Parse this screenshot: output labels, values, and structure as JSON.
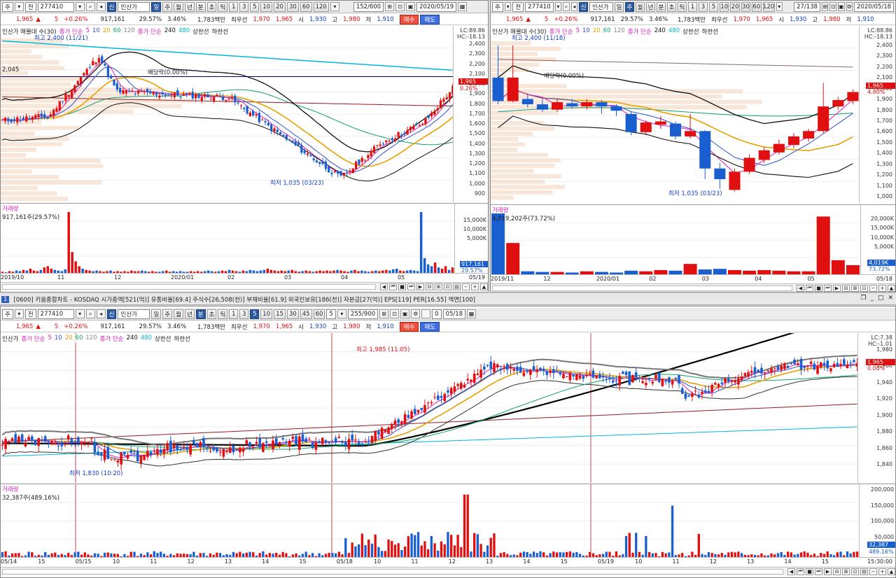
{
  "colors": {
    "up": "#e01010",
    "down": "#1a5fd0",
    "ma5": "#e020c0",
    "ma20": "#e8a000",
    "ma60": "#10a070",
    "ma120": "#00b8d8",
    "bb": "#111111"
  },
  "toolbar": {
    "mode": "주",
    "type": "전",
    "code": "277410",
    "badge": "신",
    "name": "인산가",
    "periods_left": [
      "일",
      "주",
      "월",
      "년",
      "분",
      "초",
      "틱"
    ],
    "periods_bottom": [
      "일",
      "주",
      "월",
      "년",
      "분",
      "초",
      "틱"
    ],
    "nums": [
      "1",
      "3",
      "5",
      "10",
      "20",
      "30",
      "60",
      "120"
    ],
    "nums_bottom": [
      "1",
      "3",
      "5",
      "10",
      "15",
      "30",
      "45",
      "60"
    ],
    "tl_count": "152/600",
    "tr_count": "27/138",
    "b_count": "255/900",
    "b_sel": "5",
    "tl_date": "2020/05/19",
    "tr_date": "2020/05/18",
    "b_date": "05/18",
    "b_zero": "0"
  },
  "quote": {
    "price": "1,965",
    "arrow": "▲",
    "change": "5",
    "pct": "+0.26%",
    "volume": "917,161",
    "turnover_rate": "29.57%",
    "r2": "3.46%",
    "amount": "1,783백만",
    "priority": "최우선",
    "ask": "1,970",
    "bid": "1,965",
    "open_l": "시",
    "open": "1,930",
    "high_l": "고",
    "high": "1,980",
    "low_l": "저",
    "low": "1,910",
    "buy": "매수",
    "sell": "매도"
  },
  "legend_price": {
    "name": "인산가 매물대 수(30)",
    "ma_label": "종가 단순",
    "ma": [
      "5",
      "10",
      "20",
      "60",
      "120"
    ],
    "ma2_label": "종가 단순",
    "ma2": [
      "240",
      "480"
    ],
    "band": "상한선",
    "band2": "하한선"
  },
  "legend_bottom": {
    "name": "인산가",
    "ma_label": "종가 단순",
    "ma": [
      "5",
      "10",
      "20",
      "60",
      "120"
    ],
    "ma2_label": "종가 단순",
    "ma2": [
      "240",
      "480"
    ],
    "band": "상한선",
    "band2": "하한선"
  },
  "tl": {
    "lc": "LC:89.86",
    "hc": "HC:-18.13",
    "yticks": [
      "2,400",
      "2,300",
      "2,200",
      "2,100",
      "2,000",
      "1,900",
      "1,800",
      "1,700",
      "1,600",
      "1,500",
      "1,400",
      "1,300",
      "1,200",
      "1,100",
      "1,000",
      "900"
    ],
    "tag_price": "1,965",
    "tag_pct": "0.26%",
    "hi_note": "최고 2,400 (11/21)",
    "lo_note": "최저 1,035 (03/23)",
    "div_note": "배당락(0.00%)",
    "hline_label": "2,045",
    "vol_title": "거래량",
    "vol_val": "917,161주(29.57%)",
    "vticks": [
      "15,000K",
      "10,000K",
      "5,000K"
    ],
    "vtag": "917,161",
    "vtag2": "29.57%",
    "xlabels": [
      "2019/10",
      "11",
      "12",
      "2020/01",
      "02",
      "03",
      "04",
      "05"
    ],
    "xend": "05/19",
    "vol_bars": [
      0.03,
      0.02,
      0.04,
      0.03,
      0.05,
      0.04,
      0.06,
      0.05,
      0.08,
      0.05,
      0.04,
      0.06,
      0.1,
      0.12,
      0.08,
      0.06,
      0.05,
      0.04,
      0.07,
      1.0,
      0.35,
      0.2,
      0.12,
      0.08,
      0.06,
      0.05,
      0.04,
      0.05,
      0.04,
      0.03,
      0.04,
      0.05,
      0.03,
      0.04,
      0.03,
      0.04,
      0.03,
      0.05,
      0.04,
      0.04,
      0.05,
      0.04,
      0.03,
      0.04,
      0.03,
      0.03,
      0.04,
      0.05,
      0.03,
      0.04,
      0.03,
      0.04,
      0.03,
      0.03,
      0.04,
      0.03,
      0.04,
      0.03,
      0.04,
      0.05,
      0.04,
      0.03,
      0.04,
      0.05,
      0.04,
      0.06,
      0.05,
      0.04,
      0.03,
      0.05,
      0.04,
      0.06,
      0.05,
      0.04,
      0.05,
      0.06,
      0.08,
      0.06,
      0.05,
      0.04,
      0.05,
      0.04,
      0.05,
      0.06,
      0.04,
      0.03,
      0.04,
      0.05,
      0.04,
      0.03,
      0.04,
      0.05,
      0.04,
      0.05,
      0.04,
      0.05,
      0.06,
      0.05,
      0.04,
      0.03,
      0.05,
      0.06,
      0.04,
      0.05,
      0.04,
      0.03,
      0.04,
      0.05,
      0.04,
      0.05,
      0.06,
      0.05,
      0.07,
      0.08,
      0.05,
      0.04,
      0.05,
      0.06,
      0.05,
      0.04,
      1.0,
      0.25,
      0.15,
      0.12,
      0.18,
      0.1,
      0.08,
      0.12,
      0.06,
      0.1
    ]
  },
  "tr": {
    "lc": "LC:88.86",
    "hc": "HC:-18.13",
    "yticks": [
      "2,400",
      "2,300",
      "2,200",
      "2,100",
      "2,000",
      "1,900",
      "1,800",
      "1,700",
      "1,600",
      "1,500",
      "1,400",
      "1,300",
      "1,200",
      "1,100",
      "1,000"
    ],
    "tag_price": "1,965",
    "tag_pct": "4.80%",
    "hi_note": "최고 2,400 (11/18)",
    "lo_note": "최저 1,035 (03/23)",
    "div_note": "배당락(0.00%)",
    "vol_title": "거래량",
    "vol_val": "4,019,202주(73.72%)",
    "vticks": [
      "20,000K",
      "15,000K",
      "10,000K",
      "5,000K"
    ],
    "vtag": "4,019K",
    "vtag2": "73.72%",
    "xlabels": [
      "2019/11",
      "12",
      "2020/01",
      "02",
      "03",
      "04",
      "05"
    ],
    "xend": "05/18",
    "candles": [
      {
        "o": 2100,
        "c": 1880,
        "h": 2400,
        "l": 1850
      },
      {
        "o": 1880,
        "c": 2100,
        "h": 2400,
        "l": 1870
      },
      {
        "o": 1900,
        "c": 1850,
        "h": 1950,
        "l": 1820
      },
      {
        "o": 1850,
        "c": 1800,
        "h": 1900,
        "l": 1780
      },
      {
        "o": 1800,
        "c": 1870,
        "h": 1900,
        "l": 1780
      },
      {
        "o": 1860,
        "c": 1830,
        "h": 1900,
        "l": 1810
      },
      {
        "o": 1830,
        "c": 1870,
        "h": 1900,
        "l": 1800
      },
      {
        "o": 1870,
        "c": 1830,
        "h": 1890,
        "l": 1760
      },
      {
        "o": 1830,
        "c": 1790,
        "h": 1850,
        "l": 1740
      },
      {
        "o": 1760,
        "c": 1590,
        "h": 1780,
        "l": 1560
      },
      {
        "o": 1590,
        "c": 1680,
        "h": 1700,
        "l": 1560
      },
      {
        "o": 1660,
        "c": 1690,
        "h": 1740,
        "l": 1620
      },
      {
        "o": 1670,
        "c": 1550,
        "h": 1690,
        "l": 1520
      },
      {
        "o": 1550,
        "c": 1600,
        "h": 1760,
        "l": 1530
      },
      {
        "o": 1600,
        "c": 1250,
        "h": 1610,
        "l": 1150
      },
      {
        "o": 1250,
        "c": 1150,
        "h": 1300,
        "l": 1060
      },
      {
        "o": 1050,
        "c": 1220,
        "h": 1250,
        "l": 1035
      },
      {
        "o": 1220,
        "c": 1350,
        "h": 1380,
        "l": 1200
      },
      {
        "o": 1330,
        "c": 1420,
        "h": 1450,
        "l": 1300
      },
      {
        "o": 1400,
        "c": 1480,
        "h": 1520,
        "l": 1380
      },
      {
        "o": 1470,
        "c": 1550,
        "h": 1580,
        "l": 1440
      },
      {
        "o": 1530,
        "c": 1600,
        "h": 1620,
        "l": 1500
      },
      {
        "o": 1600,
        "c": 1830,
        "h": 2050,
        "l": 1580
      },
      {
        "o": 1830,
        "c": 1890,
        "h": 1920,
        "l": 1800
      },
      {
        "o": 1880,
        "c": 1965,
        "h": 1990,
        "l": 1850
      }
    ],
    "vol_bars": [
      1.0,
      0.52,
      0.06,
      0.05,
      0.05,
      0.04,
      0.06,
      0.05,
      0.04,
      0.07,
      0.06,
      0.08,
      0.07,
      0.18,
      0.09,
      0.1,
      0.08,
      0.07,
      0.08,
      0.07,
      0.06,
      0.06,
      0.95,
      0.24,
      0.16
    ]
  },
  "titlebar": {
    "badge": "1",
    "text": "[0600] 키움종합차트 - KOSDAQ 시가총액[521(억)] 유통비율[69.4] 주식수[26,508(천)] 부채비율[61.9] 외국인보유[186(천)] 자본금[27(억)] EPS[119] PER[16.55] 액면[100]"
  },
  "bt": {
    "lc": "LC:7.38",
    "hc": "HC:-1.01",
    "yticks": [
      "1,980",
      "1,960",
      "1,940",
      "1,920",
      "1,900",
      "1,880",
      "1,860",
      "1,840"
    ],
    "tag_price": "1,965",
    "tag_pct": "0.00%",
    "hi_note": "최고 1,985 (11:05)",
    "lo_note": "최저 1,830 (10:20)",
    "vol_title": "거래량",
    "vol_val": "32,387주(489.16%)",
    "vticks": [
      "200,000",
      "150,000",
      "100,000",
      "50,000"
    ],
    "vtag": "32,387",
    "vtag2": "489.16%",
    "xlabels": [
      "05/14",
      "15",
      "05/15",
      "10",
      "11",
      "12",
      "13",
      "14",
      "15",
      "05/18",
      "10",
      "11",
      "12",
      "13",
      "14",
      "15",
      "05/19",
      "10",
      "11",
      "12",
      "13",
      "14",
      "15"
    ],
    "xend": "15:30:00"
  }
}
